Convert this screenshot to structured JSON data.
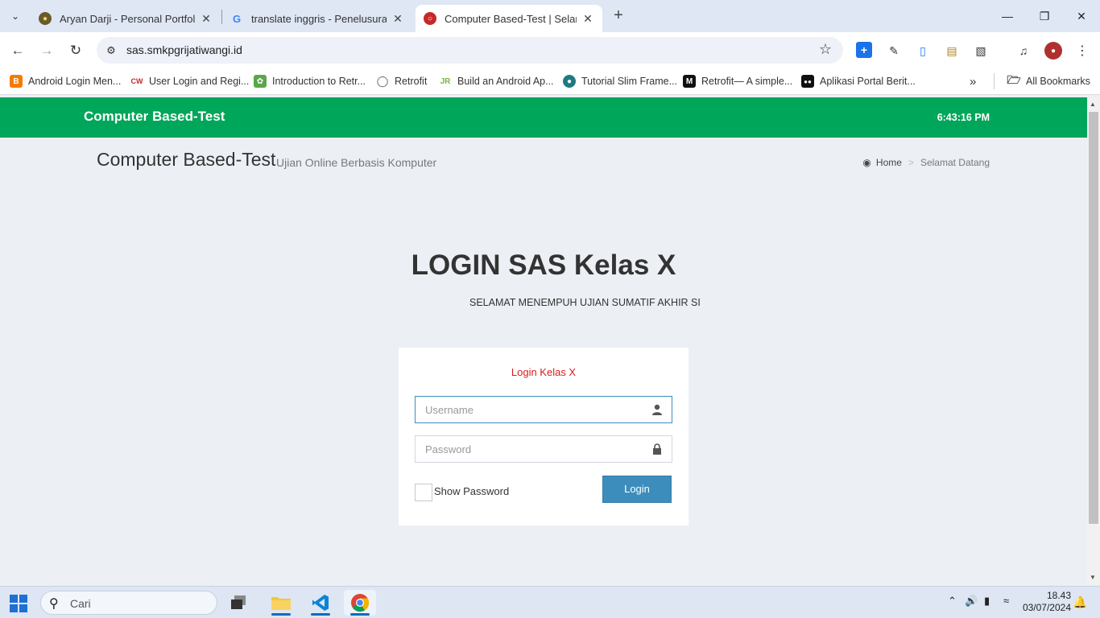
{
  "browser": {
    "tabs": [
      {
        "title": "Aryan Darji - Personal Portfolio",
        "active": false
      },
      {
        "title": "translate inggris - Penelusuran G",
        "active": false
      },
      {
        "title": "Computer Based-Test | Selamat D",
        "active": true
      }
    ],
    "new_tab_icon": "+",
    "url": "sas.smkpgrijatiwangi.id",
    "bookmarks": [
      {
        "label": "Android Login Men..."
      },
      {
        "label": "User Login and Regi..."
      },
      {
        "label": "Introduction to Retr..."
      },
      {
        "label": "Retrofit"
      },
      {
        "label": "Build an Android Ap..."
      },
      {
        "label": "Tutorial Slim Frame..."
      },
      {
        "label": "Retrofit— A simple..."
      },
      {
        "label": "Aplikasi Portal Berit..."
      }
    ],
    "all_bookmarks": "All Bookmarks"
  },
  "page": {
    "brand": "Computer Based-Test",
    "clock": "6:43:16 PM",
    "title": "Computer Based-Test",
    "subtitle": "Ujian Online Berbasis Komputer",
    "breadcrumb": {
      "home": "Home",
      "current": "Selamat Datang"
    },
    "login_heading": "LOGIN SAS Kelas X",
    "login_subheading": "SELAMAT MENEMPUH UJIAN SUMATIF AKHIR SI",
    "box_message": "Login Kelas X",
    "username_placeholder": "Username",
    "password_placeholder": "Password",
    "show_password_label": "Show Password",
    "login_button": "Login"
  },
  "taskbar": {
    "search_placeholder": "Cari",
    "time": "18.43",
    "date": "03/07/2024"
  },
  "colors": {
    "header_green": "#00a65a",
    "button_blue": "#3c8dbc",
    "message_red": "#dd1c1c",
    "page_bg": "#ecf0f5"
  }
}
